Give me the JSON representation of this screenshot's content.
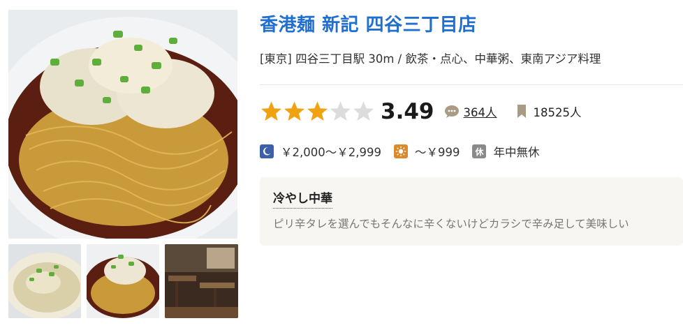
{
  "restaurant": {
    "name": "香港麺 新記 四谷三丁目店",
    "area": "[東京] 四谷三丁目駅 30m / 飲茶・点心、中華粥、東南アジア料理"
  },
  "rating": {
    "score": "3.49",
    "stars_filled": 3,
    "stars_total": 5,
    "review_count": "364人",
    "save_count": "18525人"
  },
  "budget": {
    "dinner": "￥2,000～￥2,999",
    "lunch": "～￥999",
    "holiday_badge": "休",
    "holiday": "年中無休"
  },
  "review": {
    "title": "冷やし中華",
    "snippet": "ピリ辛タレを選んでもそんなに辛くないけどカラシで辛み足して美味しい"
  },
  "colors": {
    "title": "#1f6fd1",
    "star_on": "#f0a312",
    "star_off": "#dcdcdc",
    "night": "#3b5fa8",
    "day": "#d98a2c"
  },
  "icons": {
    "review": "speech-bubble-icon",
    "save": "bookmark-icon",
    "night": "moon-icon",
    "day": "sun-icon"
  }
}
